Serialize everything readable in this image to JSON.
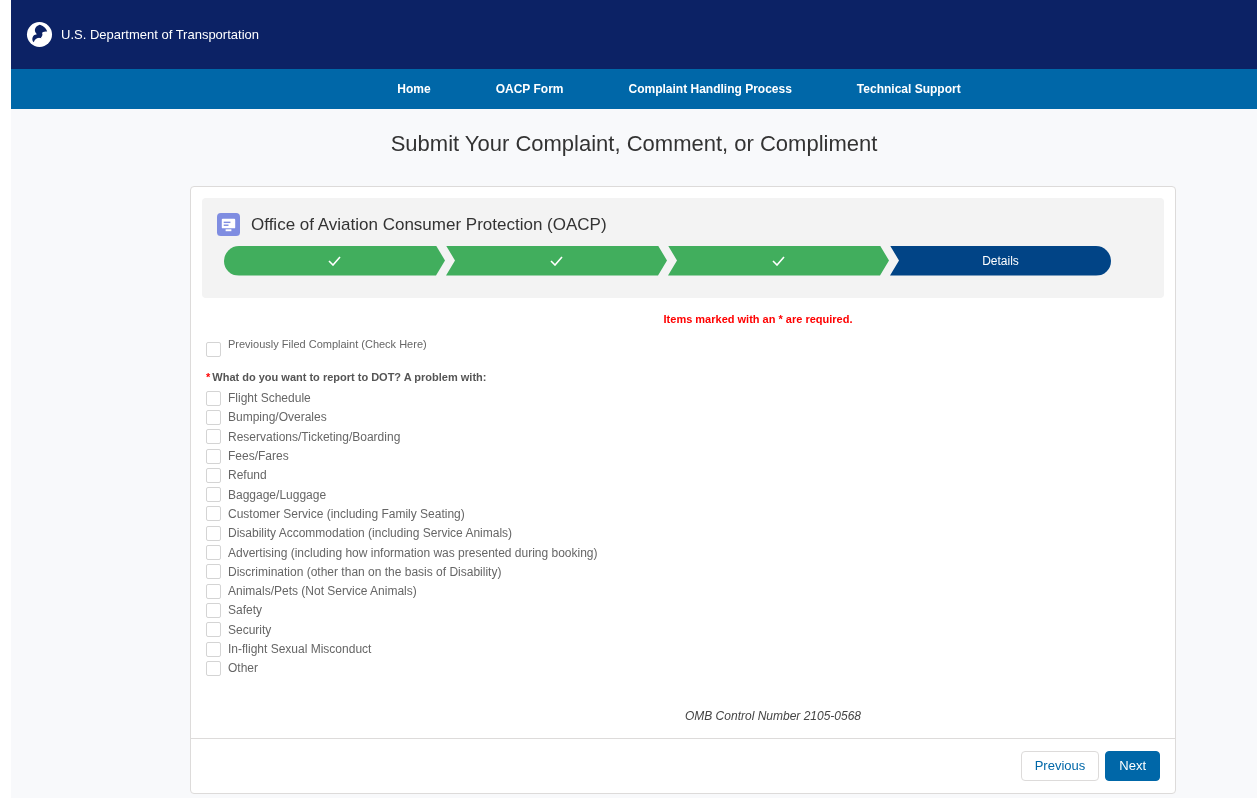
{
  "header": {
    "agency": "U.S. Department of Transportation"
  },
  "nav": [
    {
      "label": "Home"
    },
    {
      "label": "OACP Form"
    },
    {
      "label": "Complaint Handling Process"
    },
    {
      "label": "Technical Support"
    }
  ],
  "page_title": "Submit Your Complaint, Comment, or Compliment",
  "card": {
    "title": "Office of Aviation Consumer Protection (OACP)",
    "steps": [
      {
        "completed": true,
        "selected": false
      },
      {
        "completed": true,
        "selected": false
      },
      {
        "completed": true,
        "selected": false
      },
      {
        "label": "Details",
        "completed": false,
        "selected": true
      }
    ],
    "required_note": "Items marked with an * are required.",
    "previously_filed": {
      "label": "Previously Filed Complaint (Check Here)",
      "checked": false
    },
    "question": {
      "marker": "*",
      "label": "What do you want to report to DOT? A problem with:"
    },
    "options": [
      {
        "label": "Flight Schedule",
        "checked": false
      },
      {
        "label": "Bumping/Overales",
        "checked": false
      },
      {
        "label": "Reservations/Ticketing/Boarding",
        "checked": false
      },
      {
        "label": "Fees/Fares",
        "checked": false
      },
      {
        "label": "Refund",
        "checked": false
      },
      {
        "label": "Baggage/Luggage",
        "checked": false
      },
      {
        "label": "Customer Service (including Family Seating)",
        "checked": false
      },
      {
        "label": "Disability Accommodation (including Service Animals)",
        "checked": false
      },
      {
        "label": "Advertising (including how information was presented during booking)",
        "checked": false
      },
      {
        "label": "Discrimination (other than on the basis of Disability)",
        "checked": false
      },
      {
        "label": "Animals/Pets (Not Service Animals)",
        "checked": false
      },
      {
        "label": "Safety",
        "checked": false
      },
      {
        "label": "Security",
        "checked": false
      },
      {
        "label": "In-flight Sexual Misconduct",
        "checked": false
      },
      {
        "label": "Other",
        "checked": false
      }
    ],
    "omb": "OMB Control Number 2105-0568",
    "buttons": [
      {
        "label": "Previous",
        "kind": "secondary"
      },
      {
        "label": "Next",
        "kind": "primary"
      }
    ]
  }
}
